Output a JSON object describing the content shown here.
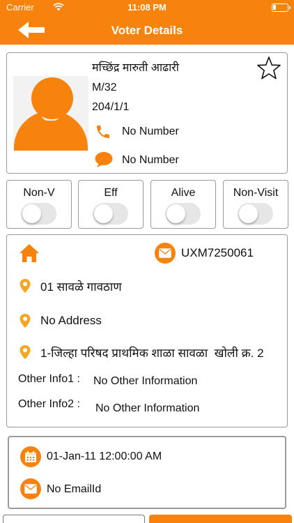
{
  "status_bar": {
    "carrier": "Carrier",
    "time": "11:08 PM",
    "wifi_icon": "wifi-icon",
    "battery_icon": "battery-icon"
  },
  "header": {
    "title": "Voter Details",
    "back_icon": "back-arrow-icon",
    "color": "#f7830f"
  },
  "profile": {
    "name": "मच्छिंद्र मारुती आढारी",
    "gender_age": "M/32",
    "code": "204/1/1",
    "phone": "No Number",
    "message": "No Number",
    "favorite_icon": "star-icon",
    "avatar_icon": "person-avatar-icon"
  },
  "toggles": [
    {
      "label": "Non-V",
      "on": false
    },
    {
      "label": "Eff",
      "on": false
    },
    {
      "label": "Alive",
      "on": false
    },
    {
      "label": "Non-Visit",
      "on": false
    }
  ],
  "info": {
    "voter_id": "UXM7250061",
    "address_line1": "01 सावळे गावठाण",
    "address_line2": "No Address",
    "booth": "1-जिल्हा परिषद प्राथमिक शाळा सावळा  खोली क्र. 2",
    "other_info1_label": "Other Info1 :",
    "other_info1_value": "No Other Information",
    "other_info2_label": "Other Info2 :",
    "other_info2_value": "No Other Information"
  },
  "contact": {
    "date": "01-Jan-11 12:00:00 AM",
    "email": "No EmailId"
  },
  "colors": {
    "accent": "#f7830f",
    "border": "#9a9a9a",
    "switch_off": "#e6e6e6"
  }
}
